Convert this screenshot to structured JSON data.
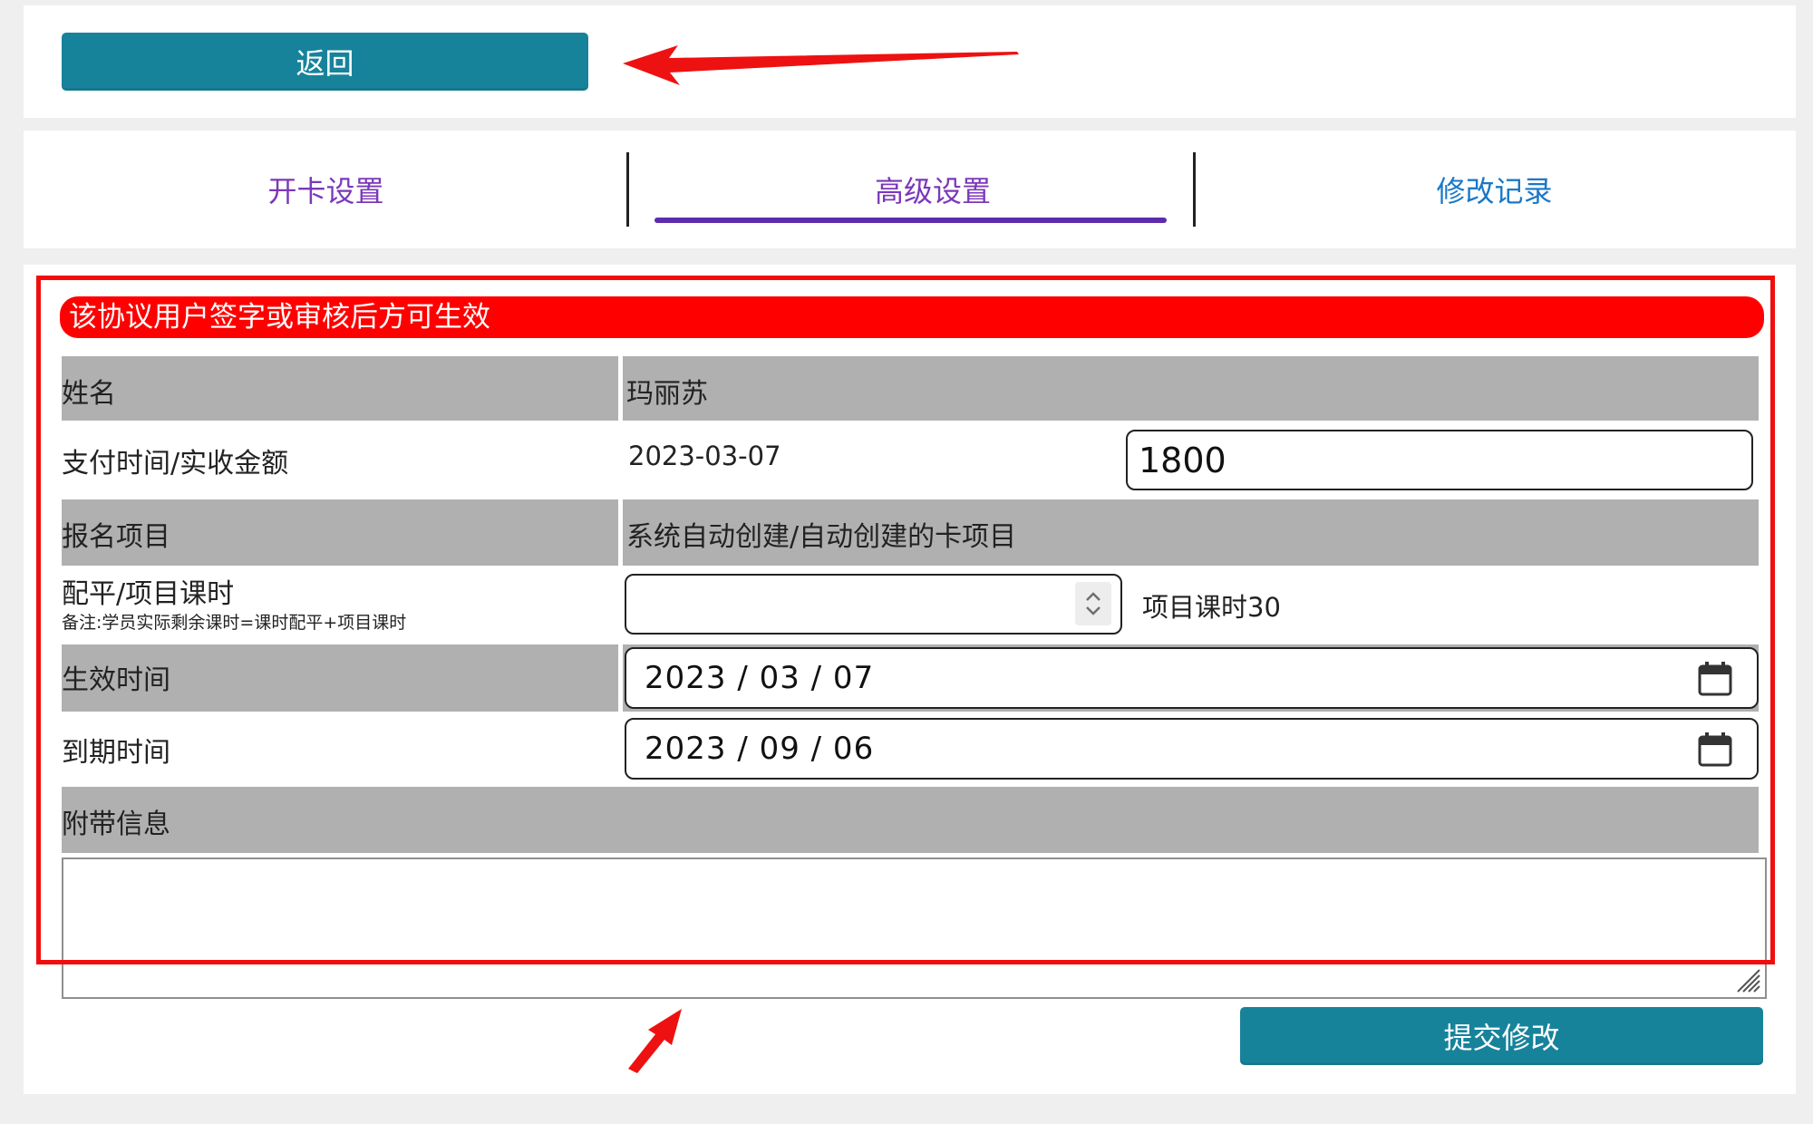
{
  "top": {
    "back_label": "返回"
  },
  "tabs": [
    {
      "label": "开卡设置"
    },
    {
      "label": "高级设置"
    },
    {
      "label": "修改记录"
    }
  ],
  "form": {
    "warning": "该协议用户签字或审核后方可生效",
    "name": {
      "label": "姓名",
      "value": "玛丽苏"
    },
    "payment": {
      "label": "支付时间/实收金额",
      "date": "2023-03-07",
      "amount": "1800"
    },
    "project": {
      "label": "报名项目",
      "value": "系统自动创建/自动创建的卡项目"
    },
    "hours": {
      "label": "配平/项目课时",
      "note": "备注:学员实际剩余课时=课时配平+项目课时",
      "input_value": "",
      "project_hours": "项目课时30"
    },
    "start": {
      "label": "生效时间",
      "value": "2023 / 03 / 07"
    },
    "end": {
      "label": "到期时间",
      "value": "2023 / 09 / 06"
    },
    "extra": {
      "label": "附带信息",
      "value": ""
    },
    "submit_label": "提交修改"
  },
  "colors": {
    "button": "#17839b",
    "warning": "#ff0000",
    "annotation": "#f20d0d",
    "active_tab": "#7b38b9",
    "history_tab": "#1a78c8",
    "tab_underline": "#5d2cad",
    "gray_row": "#b0b0b0"
  },
  "icons": {
    "stepper": "spin-arrows-icon",
    "calendar": "calendar-icon",
    "resize": "resize-handle-icon",
    "annotation_arrow": "red-arrow-icon"
  }
}
